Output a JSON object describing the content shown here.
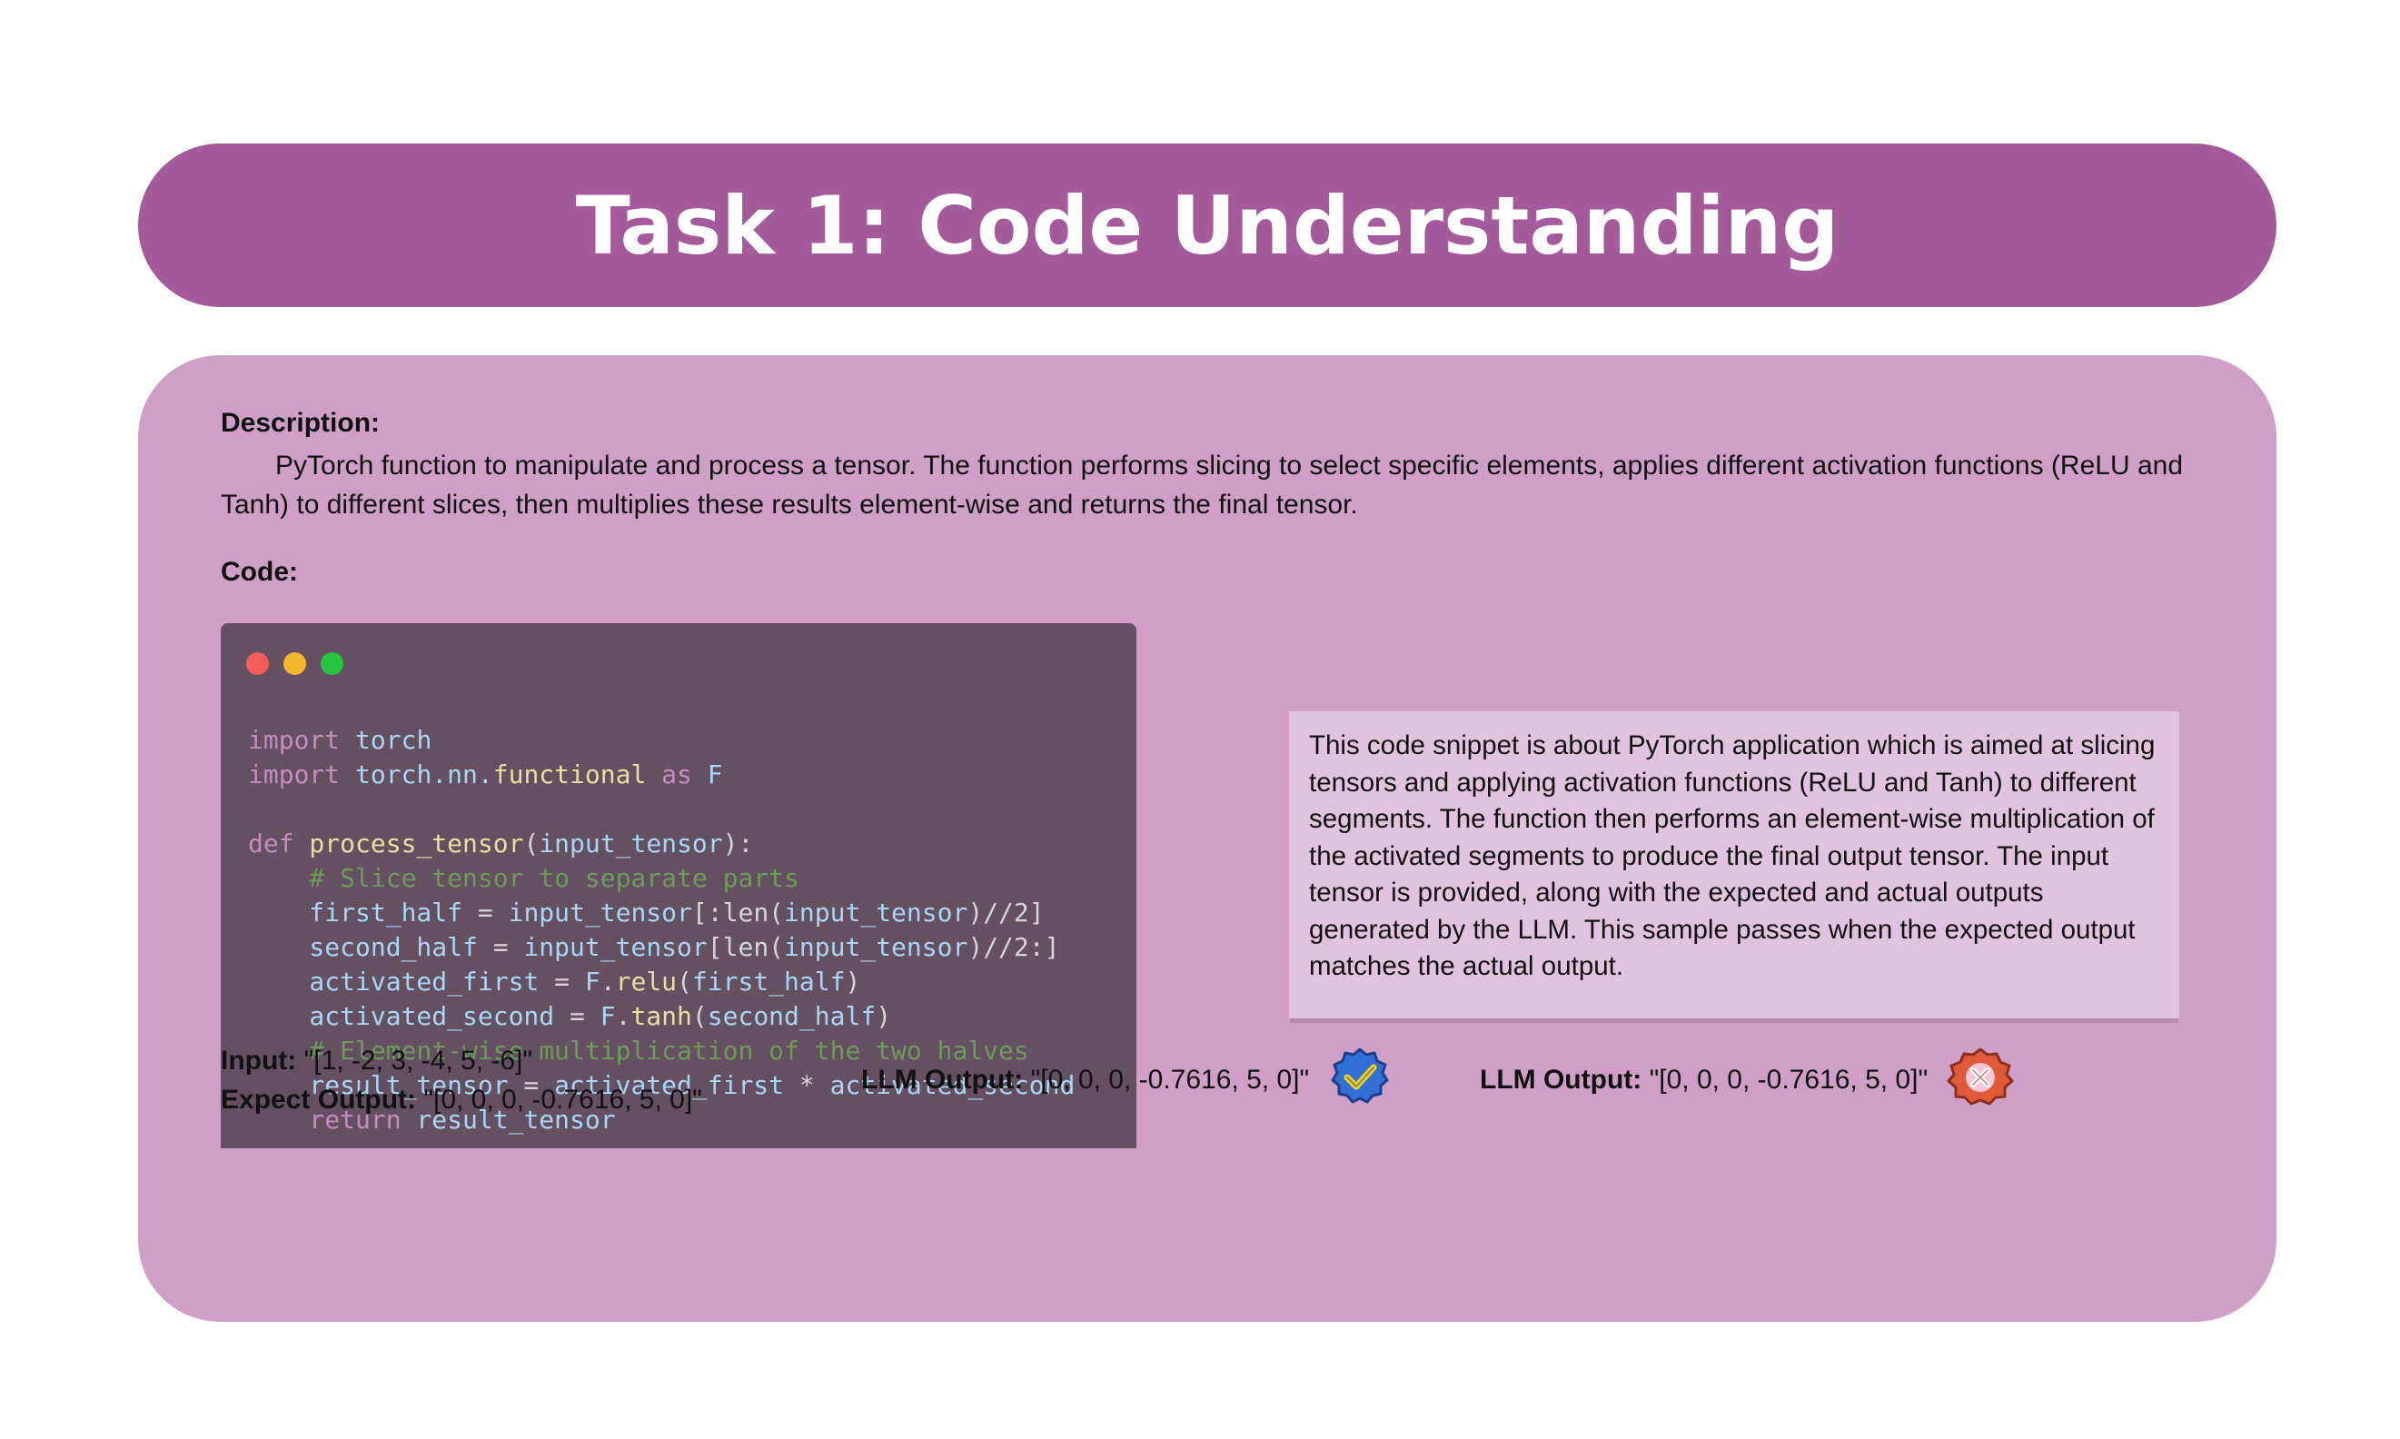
{
  "title": "Task 1: Code Understanding",
  "description": {
    "label": "Description:",
    "text": "PyTorch function to manipulate and process a tensor. The function performs slicing to select specific elements, applies different activation functions (ReLU and Tanh) to different slices, then multiplies these results element-wise and returns the final tensor."
  },
  "code": {
    "label": "Code:",
    "window_dots": [
      "#f25b57",
      "#f5b72d",
      "#27c43f"
    ],
    "lines": [
      [
        [
          "kw",
          "import"
        ],
        [
          "id",
          " torch"
        ]
      ],
      [
        [
          "kw",
          "import"
        ],
        [
          "id",
          " torch.nn."
        ],
        [
          "fn",
          "functional"
        ],
        [
          "kw",
          " as"
        ],
        [
          "id",
          " F"
        ]
      ],
      [],
      [
        [
          "kw",
          "def"
        ],
        [
          "fn",
          " process_tensor"
        ],
        [
          "op",
          "("
        ],
        [
          "id",
          "input_tensor"
        ],
        [
          "op",
          "):"
        ]
      ],
      [
        [
          "cm",
          "    # Slice tensor to separate parts"
        ]
      ],
      [
        [
          "id",
          "    first_half"
        ],
        [
          "op",
          " = "
        ],
        [
          "id",
          "input_tensor"
        ],
        [
          "op",
          "[:len("
        ],
        [
          "id",
          "input_tensor"
        ],
        [
          "op",
          ")//2]"
        ]
      ],
      [
        [
          "id",
          "    second_half"
        ],
        [
          "op",
          " = "
        ],
        [
          "id",
          "input_tensor"
        ],
        [
          "op",
          "[len("
        ],
        [
          "id",
          "input_tensor"
        ],
        [
          "op",
          ")//2:]"
        ]
      ],
      [
        [
          "id",
          "    activated_first"
        ],
        [
          "op",
          " = "
        ],
        [
          "id",
          "F"
        ],
        [
          "op",
          "."
        ],
        [
          "fn",
          "relu"
        ],
        [
          "op",
          "("
        ],
        [
          "id",
          "first_half"
        ],
        [
          "op",
          ")"
        ]
      ],
      [
        [
          "id",
          "    activated_second"
        ],
        [
          "op",
          " = "
        ],
        [
          "id",
          "F"
        ],
        [
          "op",
          "."
        ],
        [
          "fn",
          "tanh"
        ],
        [
          "op",
          "("
        ],
        [
          "id",
          "second_half"
        ],
        [
          "op",
          ")"
        ]
      ],
      [
        [
          "cm",
          "    # Element-wise multiplication of the two halves"
        ]
      ],
      [
        [
          "id",
          "    result_tensor"
        ],
        [
          "op",
          " = "
        ],
        [
          "id",
          "activated_first"
        ],
        [
          "op",
          " * "
        ],
        [
          "id",
          "activated_second"
        ]
      ],
      [
        [
          "kw",
          "    return"
        ],
        [
          "id",
          " result_tensor"
        ]
      ]
    ]
  },
  "note": {
    "text": "This code snippet is about PyTorch application which is aimed at slicing tensors and applying activation functions (ReLU and Tanh) to different segments. The function then performs an element-wise multiplication of the activated segments to produce the final output tensor. The input tensor is provided, along with the expected and actual outputs generated by the LLM. This sample passes when the expected output matches the actual output."
  },
  "io": {
    "input_label": "Input:",
    "input_value": " \"[1, -2, 3, -4, 5, -6]\"",
    "expect_label": "Expect Output:",
    "expect_value": " \"[0, 0, 0, -0.7616, 5, 0]\"",
    "llm_pass_label": "LLM Output:",
    "llm_pass_value": " \"[0, 0, 0, -0.7616, 5, 0]\"",
    "llm_fail_label": "LLM Output:",
    "llm_fail_value": " \"[0, 0, 0, -0.7616, 5, 0]\""
  },
  "icons": {
    "pass": "check-badge-icon",
    "fail": "cross-badge-icon",
    "pass_color": "#2f6fd6",
    "fail_color": "#e05a3a"
  },
  "colors": {
    "title_bar": "#a45a9b",
    "panel": "#cf9fc8",
    "code_bg": "#645061",
    "note_bg": "#e2c3df"
  }
}
